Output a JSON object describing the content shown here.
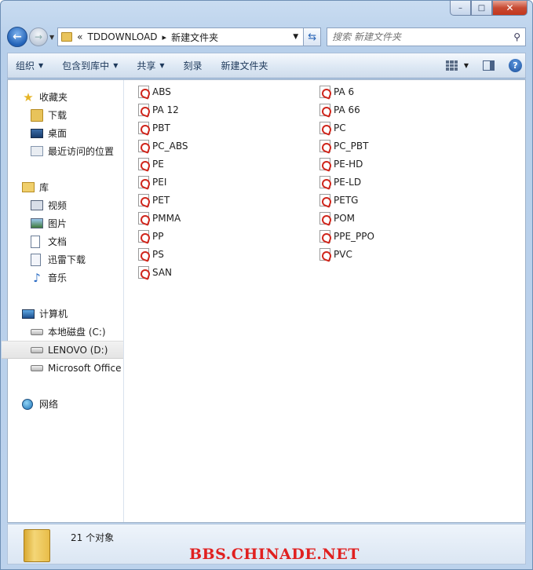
{
  "window": {
    "buttons": {
      "minimize": "–",
      "maximize": "□",
      "close": "✕"
    }
  },
  "navbar": {
    "breadcrumb": [
      "TDDOWNLOAD",
      "新建文件夹"
    ],
    "search_placeholder": "搜索 新建文件夹"
  },
  "toolbar": {
    "items": [
      {
        "label": "组织",
        "dropdown": true
      },
      {
        "label": "包含到库中",
        "dropdown": true
      },
      {
        "label": "共享",
        "dropdown": true
      },
      {
        "label": "刻录",
        "dropdown": false
      },
      {
        "label": "新建文件夹",
        "dropdown": false
      }
    ],
    "help_label": "?"
  },
  "sidebar": {
    "favorites": {
      "label": "收藏夹",
      "items": [
        "下载",
        "桌面",
        "最近访问的位置"
      ]
    },
    "libraries": {
      "label": "库",
      "items": [
        "视频",
        "图片",
        "文档",
        "迅雷下载",
        "音乐"
      ]
    },
    "computer": {
      "label": "计算机",
      "items": [
        "本地磁盘 (C:)",
        "LENOVO (D:)",
        "Microsoft Office"
      ],
      "selected": "LENOVO (D:)"
    },
    "network": {
      "label": "网络"
    }
  },
  "files": {
    "column1": [
      "ABS",
      "PA 12",
      "PBT",
      "PC_ABS",
      "PE",
      "PEI",
      "PET",
      "PMMA",
      "PP",
      "PS",
      "SAN"
    ],
    "column2": [
      "PA 6",
      "PA 66",
      "PC",
      "PC_PBT",
      "PE-HD",
      "PE-LD",
      "PETG",
      "POM",
      "PPE_PPO",
      "PVC"
    ]
  },
  "status": {
    "count_text": "21 个对象"
  },
  "watermark": "BBS.CHINADE.NET"
}
